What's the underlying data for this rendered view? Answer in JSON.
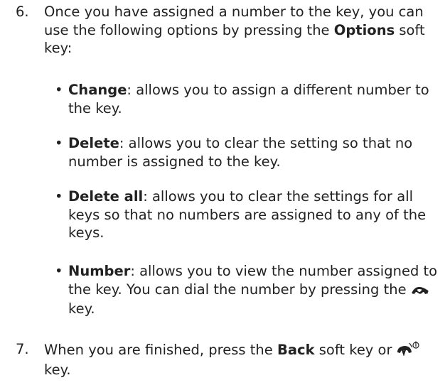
{
  "step6": {
    "number": "6.",
    "text_before": "Once you have assigned a number to the key, you can use the following options by pressing the ",
    "options_label": "Options",
    "text_after": " soft key:"
  },
  "options": [
    {
      "name": "Change",
      "description": ": allows you to assign a different number to the key."
    },
    {
      "name": "Delete",
      "description": ": allows you to clear the setting so that no number is assigned to the key."
    },
    {
      "name": "Delete all",
      "description": ": allows you to clear the settings for all keys so that no numbers are assigned to any of the keys."
    },
    {
      "name": "Number",
      "description_before": ": allows you to view the number assigned to the key. You can dial the number by pressing the ",
      "icon": "send-key-icon",
      "description_after": " key."
    }
  ],
  "step7": {
    "number": "7.",
    "text_before": "When you are finished, press the ",
    "back_label": "Back",
    "text_middle": " soft key or ",
    "icon": "end-power-key-icon",
    "text_after": " key."
  },
  "bullet_char": "•"
}
